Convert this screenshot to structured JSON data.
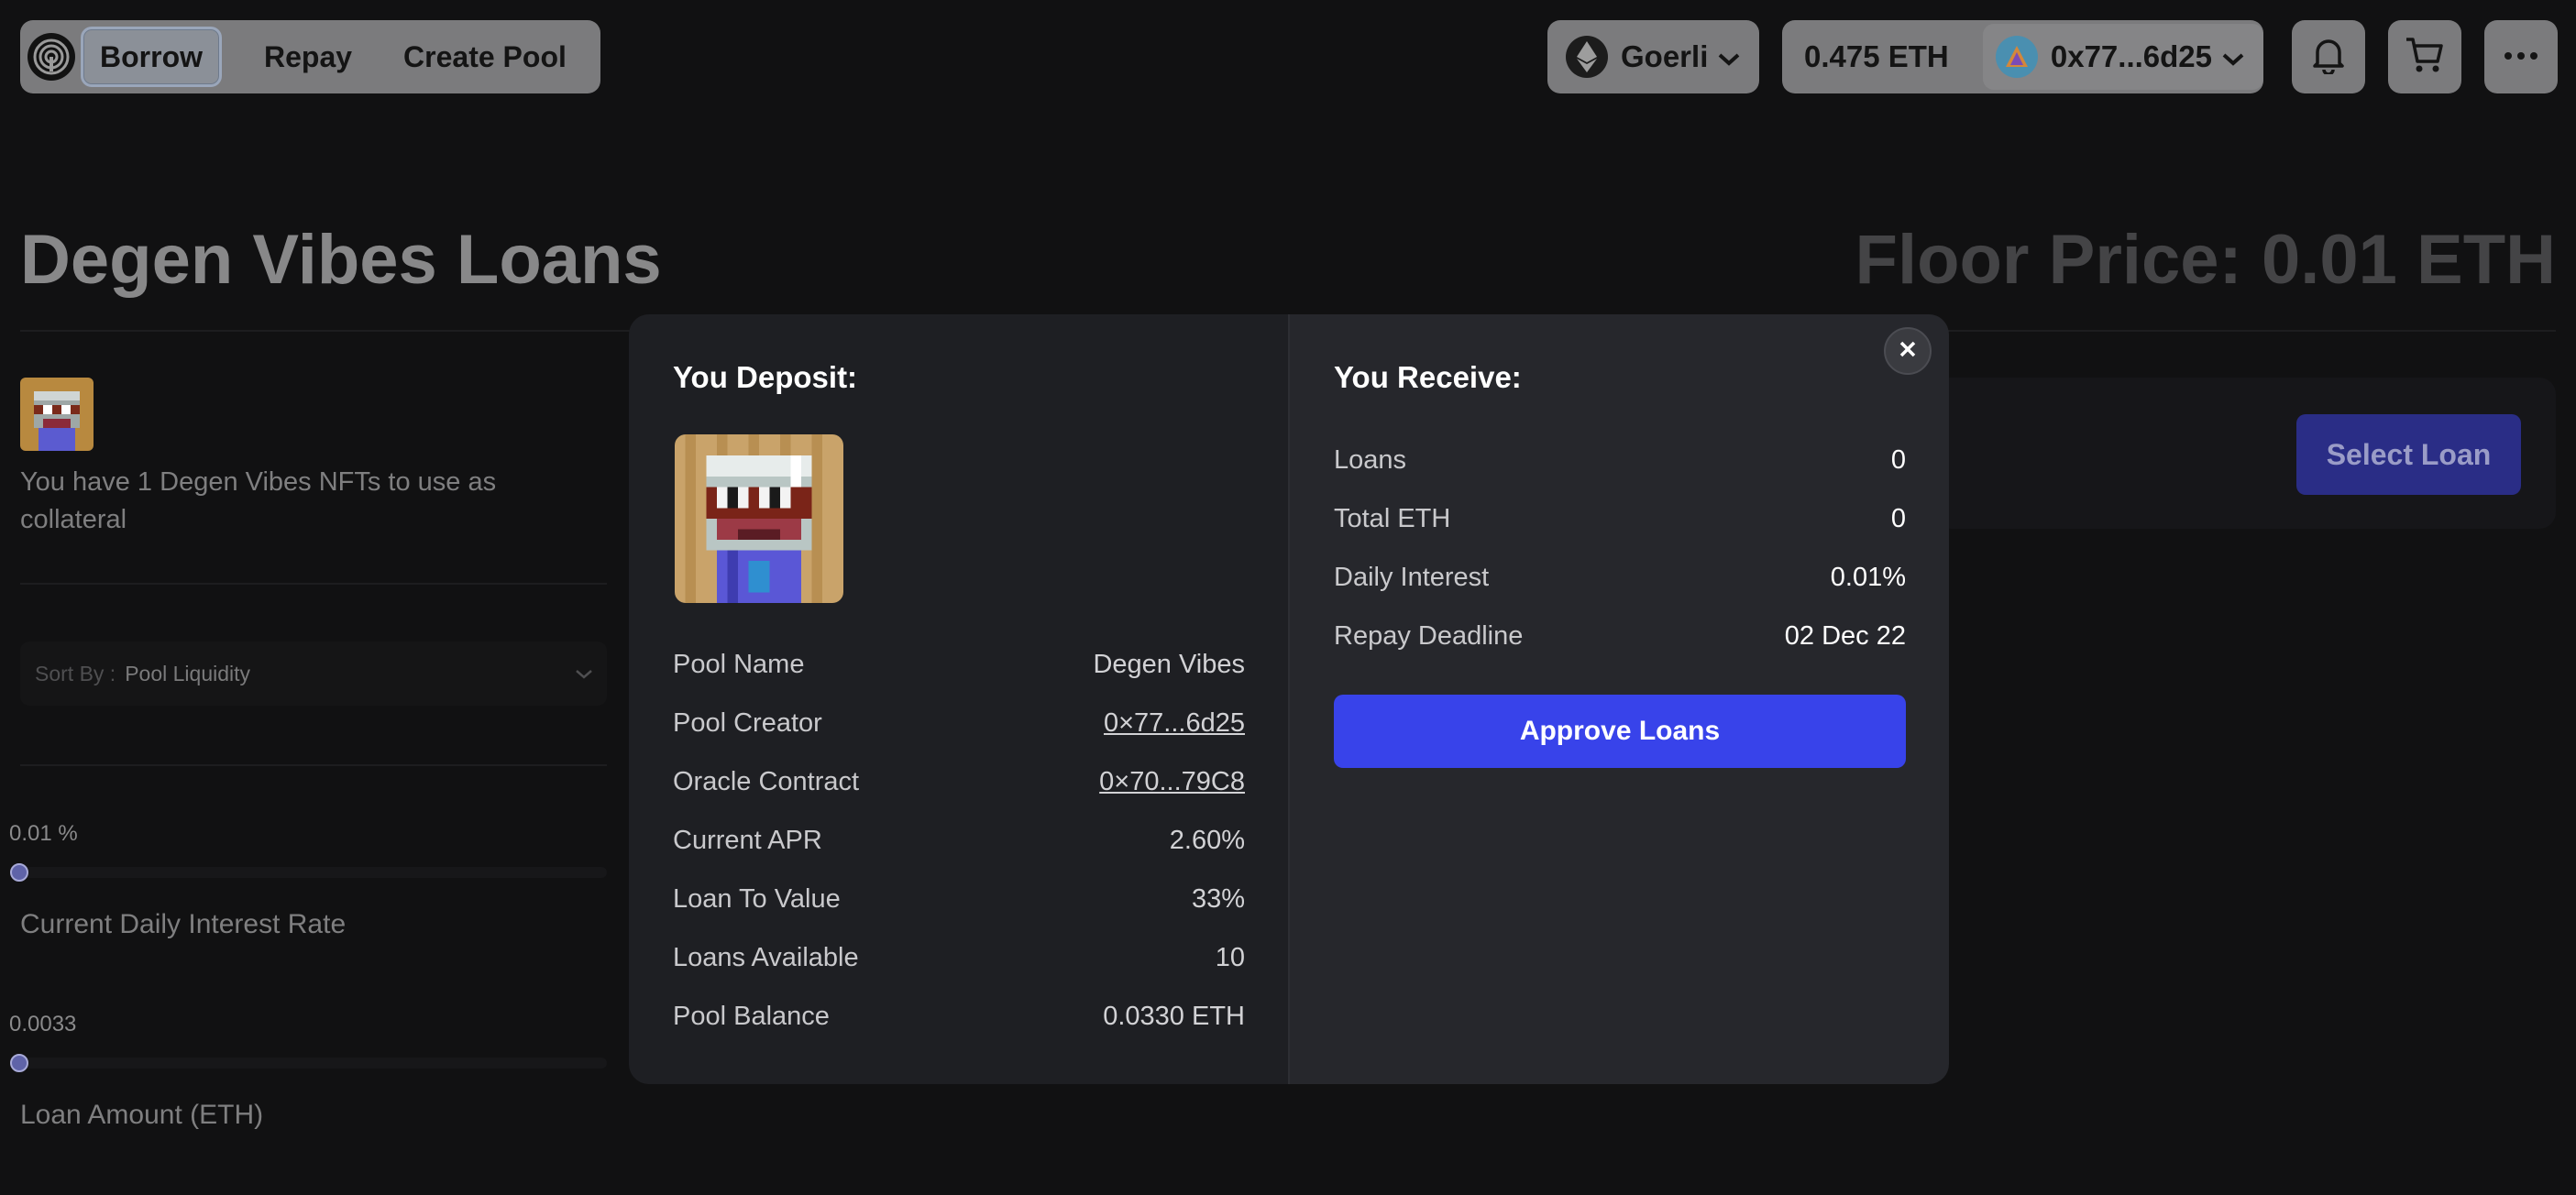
{
  "nav": {
    "items": [
      {
        "label": "Borrow",
        "active": true
      },
      {
        "label": "Repay",
        "active": false
      },
      {
        "label": "Create Pool",
        "active": false
      }
    ],
    "network": "Goerli",
    "balance": "0.475 ETH",
    "account": "0x77...6d25",
    "icons": [
      "bell-icon",
      "cart-icon",
      "more-icon"
    ]
  },
  "page": {
    "title": "Degen Vibes Loans",
    "floor_price": "Floor Price: 0.01 ETH",
    "collateral_text": "You have 1 Degen Vibes NFTs to use as collateral",
    "sort_label": "Sort By :",
    "sort_value": "Pool Liquidity",
    "interest_value": "0.01 %",
    "interest_label": "Current Daily Interest Rate",
    "loan_value": "0.0033",
    "loan_label": "Loan Amount (ETH)",
    "select_loan": "Select Loan"
  },
  "modal": {
    "deposit_title": "You Deposit:",
    "deposit_rows": [
      {
        "key": "Pool Name",
        "value": "Degen Vibes",
        "link": false
      },
      {
        "key": "Pool Creator",
        "value": "0×77...6d25",
        "link": true
      },
      {
        "key": "Oracle Contract",
        "value": "0×70...79C8",
        "link": true
      },
      {
        "key": "Current APR",
        "value": "2.60%",
        "link": false
      },
      {
        "key": "Loan To Value",
        "value": "33%",
        "link": false
      },
      {
        "key": "Loans Available",
        "value": "10",
        "link": false
      },
      {
        "key": "Pool Balance",
        "value": "0.0330 ETH",
        "link": false
      }
    ],
    "receive_title": "You Receive:",
    "receive_rows": [
      {
        "key": "Loans",
        "value": "0"
      },
      {
        "key": "Total ETH",
        "value": "0"
      },
      {
        "key": "Daily Interest",
        "value": "0.01%"
      },
      {
        "key": "Repay Deadline",
        "value": "02 Dec 22"
      }
    ],
    "approve_label": "Approve Loans"
  },
  "colors": {
    "accent": "#3843ea",
    "nav_pill": "#7b7b7d",
    "modal_left": "#1e1f23",
    "modal_right": "#26272c"
  }
}
